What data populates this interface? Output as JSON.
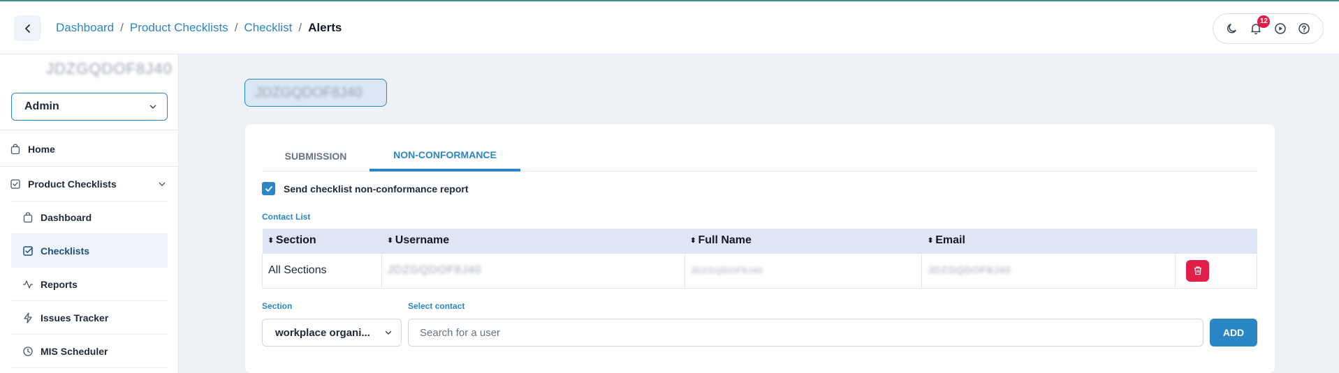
{
  "breadcrumb": {
    "items": [
      "Dashboard",
      "Product Checklists",
      "Checklist"
    ],
    "current": "Alerts",
    "separator": "/"
  },
  "header": {
    "notification_count": "12",
    "icons": [
      "moon-icon",
      "bell-icon",
      "play-icon",
      "help-icon"
    ]
  },
  "sidebar": {
    "org_name": "JDZGQDOF8J40",
    "role": "Admin",
    "items": [
      {
        "label": "Home",
        "icon": "bag-icon"
      },
      {
        "label": "Product Checklists",
        "icon": "checkbox-icon"
      }
    ],
    "sub_items": [
      {
        "label": "Dashboard",
        "icon": "bag-icon"
      },
      {
        "label": "Checklists",
        "icon": "check-square-icon"
      },
      {
        "label": "Reports",
        "icon": "activity-icon"
      },
      {
        "label": "Issues Tracker",
        "icon": "bolt-icon"
      },
      {
        "label": "MIS Scheduler",
        "icon": "clock-icon"
      }
    ]
  },
  "checklist_name": "JDZGQDOF8J40",
  "tabs": [
    "SUBMISSION",
    "NON-CONFORMANCE"
  ],
  "active_tab": "NON-CONFORMANCE",
  "report_checkbox": {
    "label": "Send checklist non-conformance report",
    "checked": true
  },
  "contact_list": {
    "label": "Contact List",
    "columns": [
      "Section",
      "Username",
      "Full Name",
      "Email"
    ],
    "rows": [
      {
        "section": "All Sections",
        "username": "JDZGQDOF8J40",
        "full_name": "JDZGQDOF8J40",
        "email": "JDZGQDOF8J40"
      }
    ]
  },
  "form": {
    "section_label": "Section",
    "section_value": "workplace organi...",
    "contact_label": "Select contact",
    "contact_placeholder": "Search for a user",
    "add_label": "ADD"
  },
  "colors": {
    "accent": "#2b86c5",
    "danger": "#e11d48",
    "background": "#eef2f7"
  }
}
